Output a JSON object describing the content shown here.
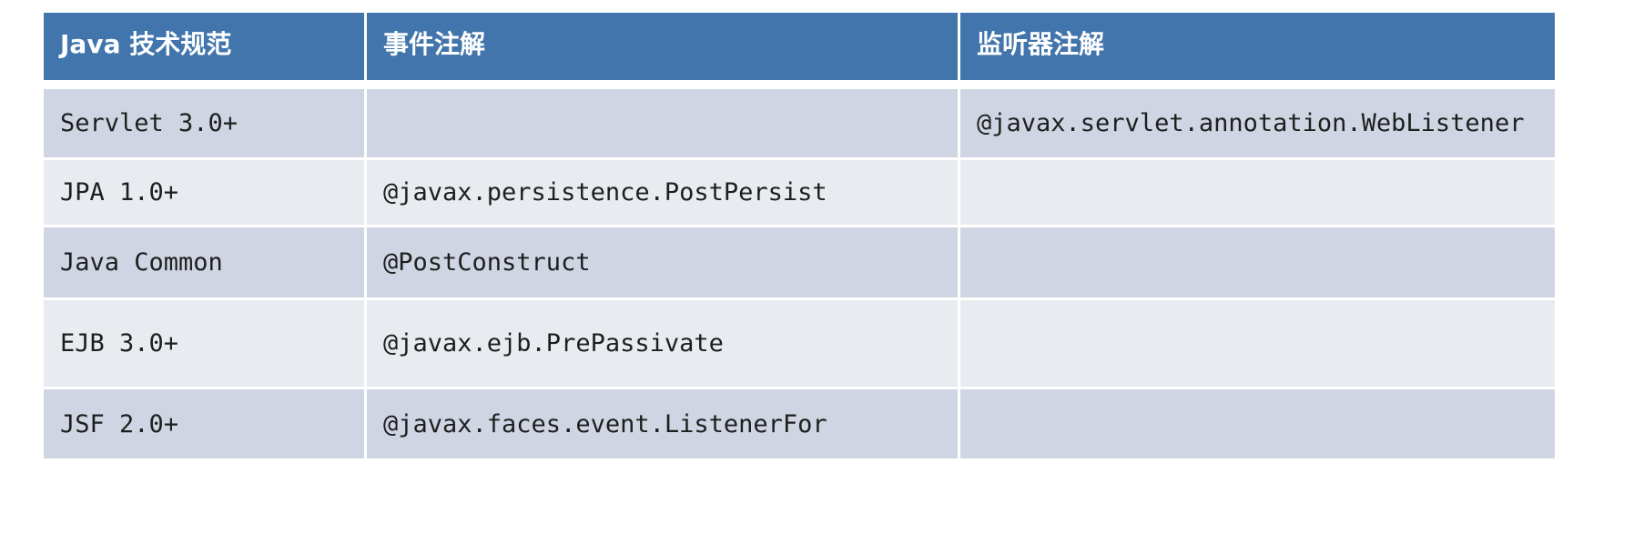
{
  "table": {
    "headers": [
      "Java 技术规范",
      "事件注解",
      "监听器注解"
    ],
    "rows": [
      [
        "Servlet 3.0+",
        "",
        "@javax.servlet.annotation.WebListener"
      ],
      [
        "JPA 1.0+",
        "@javax.persistence.PostPersist",
        ""
      ],
      [
        "Java Common",
        "@PostConstruct",
        ""
      ],
      [
        "EJB 3.0+",
        "@javax.ejb.PrePassivate",
        ""
      ],
      [
        "JSF 2.0+",
        "@javax.faces.event.ListenerFor",
        ""
      ]
    ]
  },
  "colors": {
    "header_bg": "#4275ac",
    "header_text": "#ffffff",
    "row_dark": "#cfd5e2",
    "row_light": "#e8ebf0"
  }
}
